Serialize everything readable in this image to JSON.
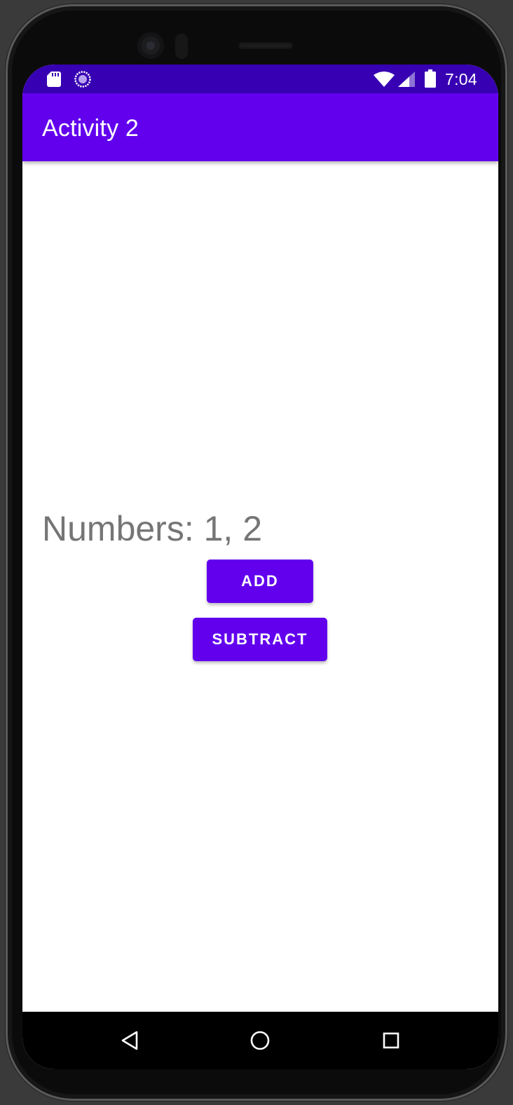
{
  "status_bar": {
    "time": "7:04",
    "icons": [
      "sd-card-icon",
      "sync-icon",
      "wifi-icon",
      "cell-signal-icon",
      "battery-icon"
    ]
  },
  "app_bar": {
    "title": "Activity 2"
  },
  "main": {
    "numbers_text": "Numbers: 1, 2",
    "add_label": "ADD",
    "subtract_label": "SUBTRACT"
  },
  "nav_bar": {
    "icons": [
      "back-icon",
      "home-icon",
      "recents-icon"
    ]
  },
  "colors": {
    "status_bar": "#3700b3",
    "primary": "#6200ee",
    "text_secondary": "#757575",
    "background": "#ffffff"
  }
}
